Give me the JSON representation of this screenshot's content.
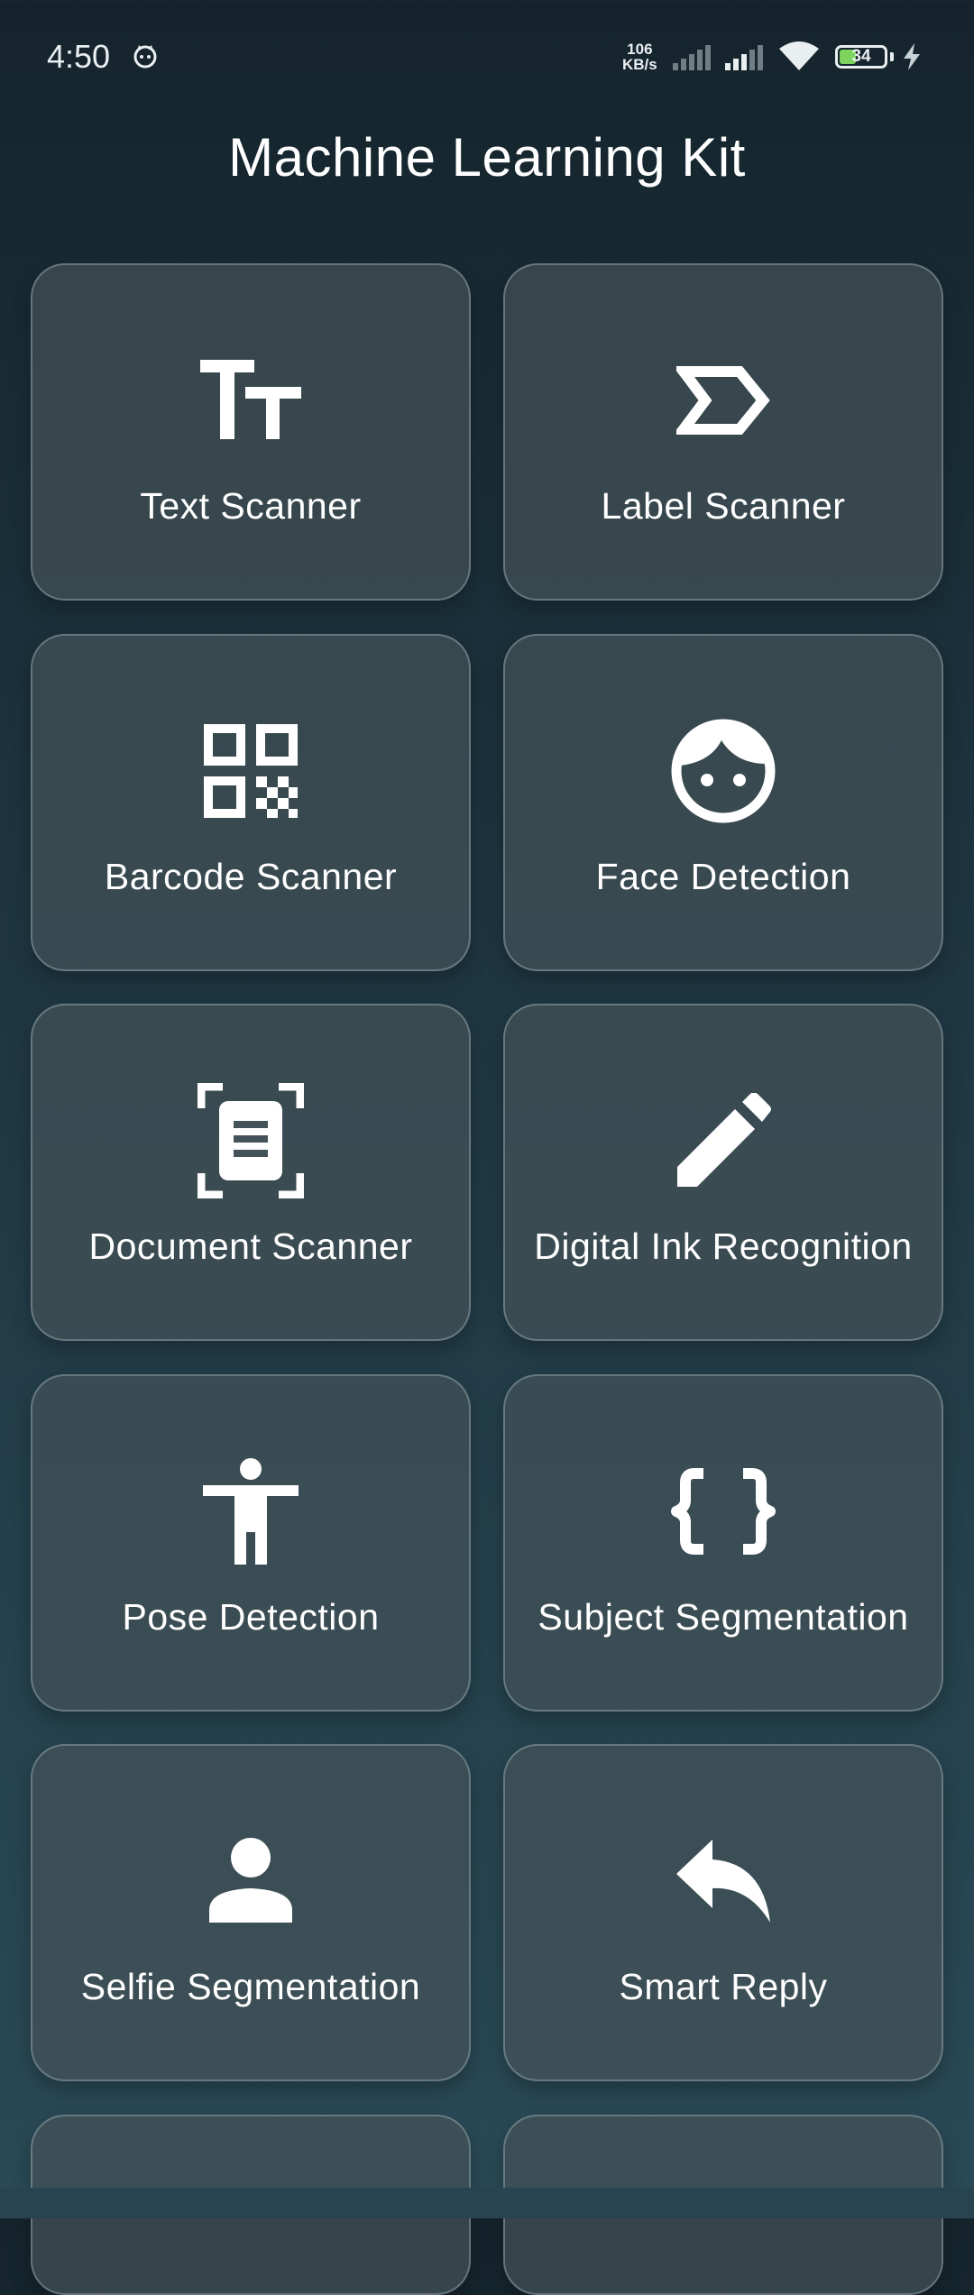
{
  "status_bar": {
    "time": "4:50",
    "net_speed_value": "106",
    "net_speed_unit": "KB/s",
    "battery": "34",
    "icons": [
      "cat-icon",
      "signal-icon",
      "signal-icon",
      "wifi-icon",
      "battery-icon",
      "charging-icon"
    ]
  },
  "app_title": "Machine Learning Kit",
  "features": [
    {
      "label": "Text Scanner",
      "icon": "text-fields-icon"
    },
    {
      "label": "Label Scanner",
      "icon": "label-icon"
    },
    {
      "label": "Barcode Scanner",
      "icon": "qr-code-icon"
    },
    {
      "label": "Face Detection",
      "icon": "face-icon"
    },
    {
      "label": "Document Scanner",
      "icon": "document-scanner-icon"
    },
    {
      "label": "Digital Ink Recognition",
      "icon": "pencil-icon"
    },
    {
      "label": "Pose Detection",
      "icon": "accessibility-icon"
    },
    {
      "label": "Subject Segmentation",
      "icon": "curly-braces-icon"
    },
    {
      "label": "Selfie Segmentation",
      "icon": "person-icon"
    },
    {
      "label": "Smart Reply",
      "icon": "reply-icon"
    }
  ],
  "colors": {
    "background_top": "#15242c",
    "background_bottom": "#2a4a57",
    "card": "#445258",
    "battery_fill": "#7ed35e"
  }
}
